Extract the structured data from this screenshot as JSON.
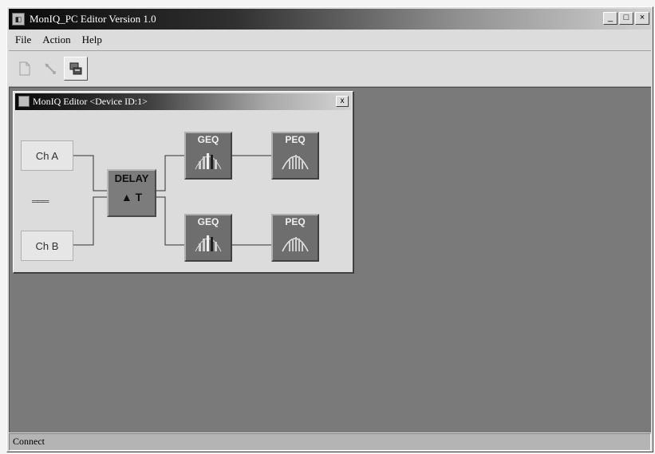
{
  "window": {
    "title": "MonIQ_PC Editor Version 1.0",
    "minimize": "_",
    "maximize": "□",
    "close": "×"
  },
  "menu": {
    "items": [
      "File",
      "Action",
      "Help"
    ]
  },
  "toolbar": {
    "buttons": [
      "new-icon",
      "connect-icon",
      "device-icon"
    ]
  },
  "child_window": {
    "title": "MonIQ Editor <Device ID:1>",
    "close": "x"
  },
  "routing": {
    "channel_a": "Ch A",
    "channel_b": "Ch B",
    "link_symbol": "═══",
    "delay_label": "DELAY",
    "delay_symbol": "▲ T",
    "geq_top": "GEQ",
    "peq_top": "PEQ",
    "geq_bottom": "GEQ",
    "peq_bottom": "PEQ"
  },
  "status": {
    "text": "Connect"
  }
}
